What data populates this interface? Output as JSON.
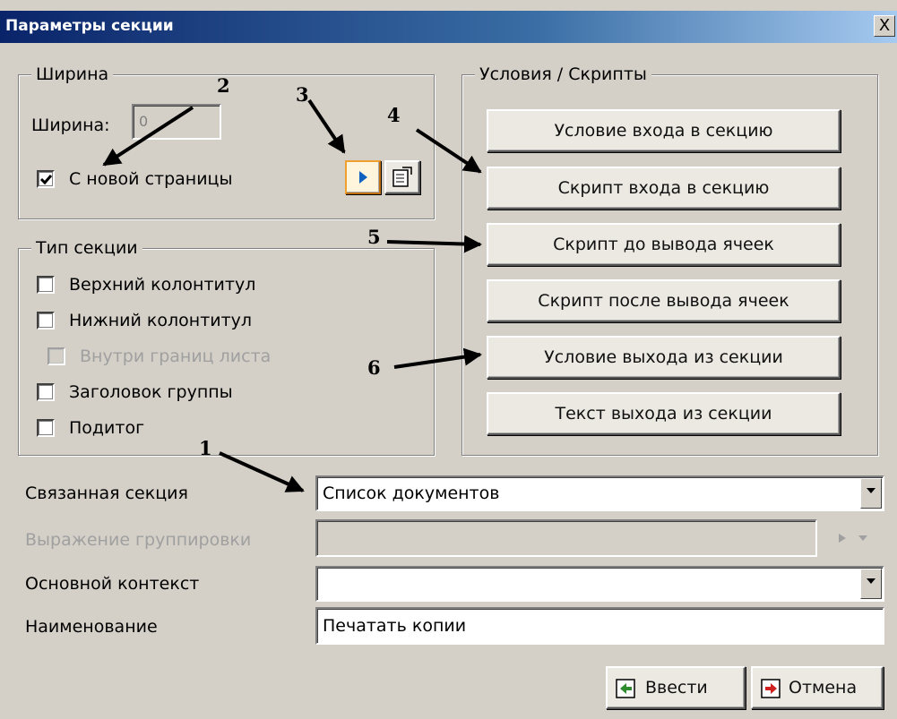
{
  "window": {
    "title": "Параметры секции",
    "close_glyph": "X"
  },
  "width_group": {
    "legend": "Ширина",
    "width_label": "Ширина:",
    "width_value": "0",
    "new_page_label": "С новой страницы",
    "new_page_checked": true
  },
  "section_type_group": {
    "legend": "Тип секции",
    "items": [
      {
        "label": "Верхний колонтитул",
        "checked": false,
        "enabled": true
      },
      {
        "label": "Нижний колонтитул",
        "checked": false,
        "enabled": true
      },
      {
        "label": "Внутри границ листа",
        "checked": false,
        "enabled": false
      },
      {
        "label": "Заголовок группы",
        "checked": false,
        "enabled": true
      },
      {
        "label": "Подитог",
        "checked": false,
        "enabled": true
      }
    ]
  },
  "scripts_group": {
    "legend": "Условия / Скрипты",
    "buttons": [
      "Условие входа в секцию",
      "Скрипт входа в секцию",
      "Скрипт до вывода ячеек",
      "Скрипт после вывода ячеек",
      "Условие выхода из секции",
      "Текст выхода из секции"
    ]
  },
  "fields": {
    "linked_section": {
      "label": "Связанная секция",
      "value": "Список документов"
    },
    "grouping_expression": {
      "label": "Выражение группировки",
      "value": ""
    },
    "main_context": {
      "label": "Основной контекст",
      "value": ""
    },
    "name": {
      "label": "Наименование",
      "value": "Печатать копии"
    }
  },
  "buttons": {
    "ok": "Ввести",
    "cancel": "Отмена"
  },
  "annotations": [
    "1",
    "2",
    "3",
    "4",
    "5",
    "6"
  ],
  "icons": [
    "checkmark-icon",
    "play-icon",
    "properties-icon",
    "ok-icon",
    "cancel-icon",
    "dropdown-arrow-icon"
  ]
}
